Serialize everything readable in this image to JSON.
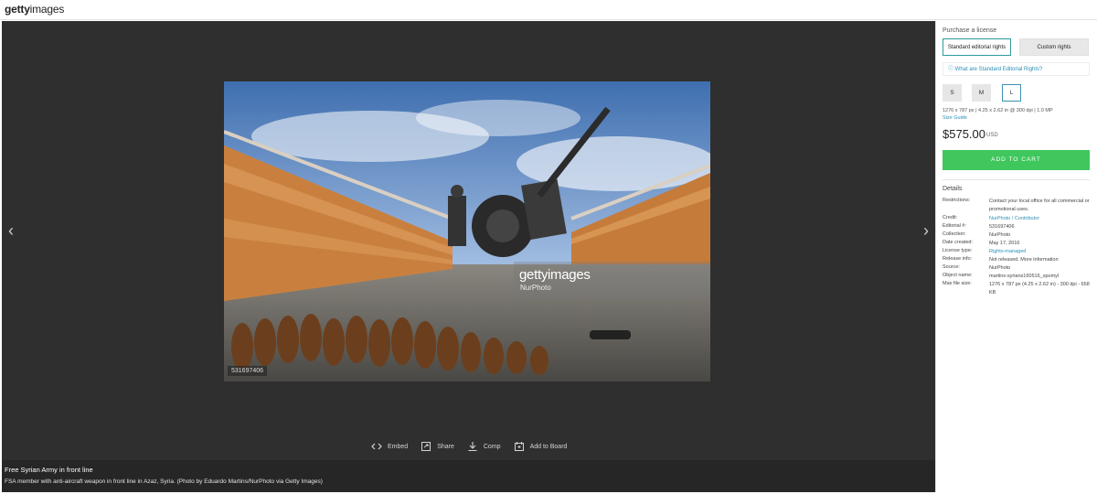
{
  "header": {
    "logo_bold": "getty",
    "logo_light": "images"
  },
  "viewer": {
    "prev_icon": "chevron-left-icon",
    "next_icon": "chevron-right-icon",
    "watermark_brand": "gettyimages",
    "watermark_credit": "NurPhoto",
    "image_id": "531697406"
  },
  "actions": [
    {
      "label": "Embed",
      "icon": "code-icon"
    },
    {
      "label": "Share",
      "icon": "share-icon"
    },
    {
      "label": "Comp",
      "icon": "download-icon"
    },
    {
      "label": "Add to Board",
      "icon": "board-icon"
    }
  ],
  "caption": {
    "title": "Free Syrian Army in front line",
    "description": "FSA member with anti-aircraft weapon in front line in Azaz, Syria. (Photo by Eduardo Martins/NurPhoto via Getty Images)"
  },
  "panel": {
    "heading": "Purchase a license",
    "tab_standard": "Standard editorial rights",
    "tab_custom": "Custom rights",
    "rights_link": "What are Standard Editorial Rights?",
    "sizes": [
      "S",
      "M",
      "L"
    ],
    "selected_size": "L",
    "size_info": "1276 x 787 px | 4.25 x 2.62 in @ 300 dpi | 1.0 MP",
    "size_guide": "Size Guide",
    "price": "$575.00",
    "currency": "USD",
    "cart_button": "ADD TO CART",
    "details_heading": "Details",
    "details": [
      {
        "label": "Restrictions:",
        "value": "Contact your local office for all commercial or promotional uses."
      },
      {
        "label": "Credit:",
        "value": "NurPhoto / Contributor"
      },
      {
        "label": "Editorial #:",
        "value": "531697406"
      },
      {
        "label": "Collection:",
        "value": "NurPhoto"
      },
      {
        "label": "Date created:",
        "value": "May 17, 2016"
      },
      {
        "label": "License type:",
        "value": "Rights-managed"
      },
      {
        "label": "Release info:",
        "value": "Not released. More information"
      },
      {
        "label": "Source:",
        "value": "NurPhoto"
      },
      {
        "label": "Object name:",
        "value": "martins-syrians160516_spomyl"
      },
      {
        "label": "Max file size:",
        "value": "1276 x 787 px (4.25 x 2.62 in) - 300 dpi - 658 KB"
      }
    ]
  },
  "colors": {
    "accent_teal": "#2c9b9b",
    "link_blue": "#2c8fb5",
    "cart_green": "#3fc75d",
    "viewer_bg": "#2f2f2f"
  }
}
